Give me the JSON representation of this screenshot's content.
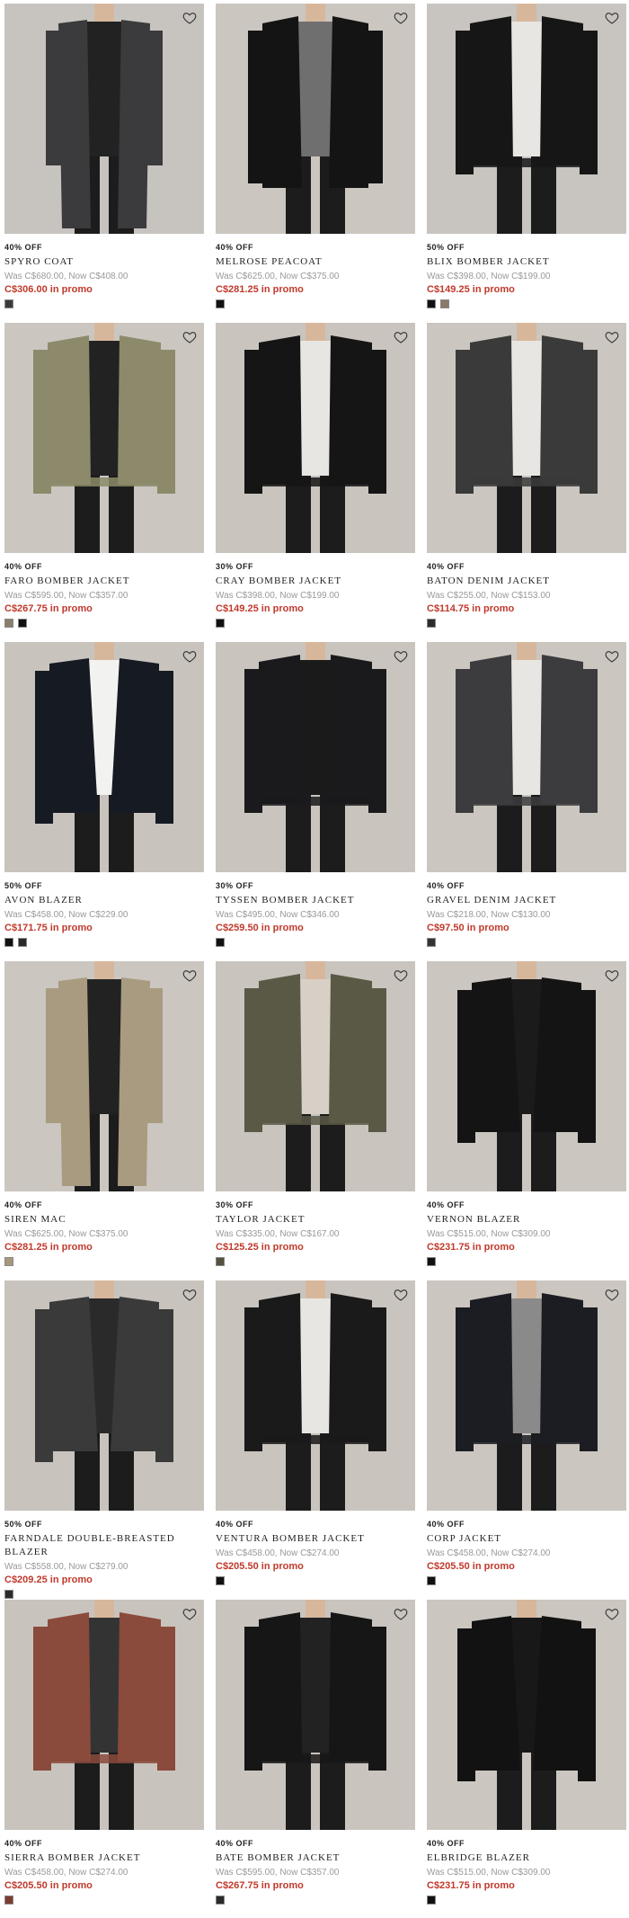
{
  "products": [
    {
      "discount": "40% OFF",
      "name": "SPYRO COAT",
      "was": "Was C$680.00, Now C$408.00",
      "promo": "C$306.00 in promo",
      "swatches": [
        "#3a3a3a"
      ],
      "garment": "#3b3b3d",
      "inner": "#222",
      "bg": "#c7c3bf",
      "style": "long"
    },
    {
      "discount": "40% OFF",
      "name": "MELROSE PEACOAT",
      "was": "Was C$625.00, Now C$375.00",
      "promo": "C$281.25 in promo",
      "swatches": [
        "#111111"
      ],
      "garment": "#141414",
      "inner": "#6f6f6f",
      "bg": "#cbc6c0",
      "style": "coat"
    },
    {
      "discount": "50% OFF",
      "name": "BLIX BOMBER JACKET",
      "was": "Was C$398.00, Now C$199.00",
      "promo": "C$149.25 in promo",
      "swatches": [
        "#111111",
        "#8a7a66"
      ],
      "garment": "#161616",
      "inner": "#e8e6e2",
      "bg": "#c8c4bf",
      "style": "bomber"
    },
    {
      "discount": "40% OFF",
      "name": "FARO BOMBER JACKET",
      "was": "Was C$595.00, Now C$357.00",
      "promo": "C$267.75 in promo",
      "swatches": [
        "#8a7f68",
        "#111111"
      ],
      "garment": "#8c8a6a",
      "inner": "#222",
      "bg": "#cbc6c0",
      "style": "bomber"
    },
    {
      "discount": "30% OFF",
      "name": "CRAY BOMBER JACKET",
      "was": "Was C$398.00, Now C$199.00",
      "promo": "C$149.25 in promo",
      "swatches": [
        "#111111"
      ],
      "garment": "#151515",
      "inner": "#e8e6e2",
      "bg": "#c9c4be",
      "style": "bomber"
    },
    {
      "discount": "40% OFF",
      "name": "BATON DENIM JACKET",
      "was": "Was C$255.00, Now C$153.00",
      "promo": "C$114.75 in promo",
      "swatches": [
        "#2b2b2b"
      ],
      "garment": "#3a3a3a",
      "inner": "#e8e6e2",
      "bg": "#cbc6c0",
      "style": "bomber"
    },
    {
      "discount": "50% OFF",
      "name": "AVON BLAZER",
      "was": "Was C$458.00, Now C$229.00",
      "promo": "C$171.75 in promo",
      "swatches": [
        "#111111",
        "#2a2a2a"
      ],
      "garment": "#161a22",
      "inner": "#f2f2f0",
      "bg": "#c8c3bd",
      "style": "blazer"
    },
    {
      "discount": "30% OFF",
      "name": "TYSSEN BOMBER JACKET",
      "was": "Was C$495.00, Now C$346.00",
      "promo": "C$259.50 in promo",
      "swatches": [
        "#111111"
      ],
      "garment": "#1a1a1c",
      "inner": "#1a1a1a",
      "bg": "#c9c4be",
      "style": "bomber"
    },
    {
      "discount": "40% OFF",
      "name": "GRAVEL DENIM JACKET",
      "was": "Was C$218.00, Now C$130.00",
      "promo": "C$97.50 in promo",
      "swatches": [
        "#333333"
      ],
      "garment": "#3c3c3e",
      "inner": "#e8e6e2",
      "bg": "#cbc6c0",
      "style": "bomber"
    },
    {
      "discount": "40% OFF",
      "name": "SIREN MAC",
      "was": "Was C$625.00, Now C$375.00",
      "promo": "C$281.25 in promo",
      "swatches": [
        "#a8987a"
      ],
      "garment": "#a89b80",
      "inner": "#222",
      "bg": "#cbc6c0",
      "style": "long"
    },
    {
      "discount": "30% OFF",
      "name": "TAYLOR JACKET",
      "was": "Was C$335.00, Now C$167.00",
      "promo": "C$125.25 in promo",
      "swatches": [
        "#555040"
      ],
      "garment": "#5a5946",
      "inner": "#d8d0c6",
      "bg": "#c9c4be",
      "style": "bomber"
    },
    {
      "discount": "40% OFF",
      "name": "VERNON BLAZER",
      "was": "Was C$515.00, Now C$309.00",
      "promo": "C$231.75 in promo",
      "swatches": [
        "#111111"
      ],
      "garment": "#141414",
      "inner": "#1b1b1b",
      "bg": "#cbc6c0",
      "style": "blazer"
    },
    {
      "discount": "50% OFF",
      "name": "FARNDALE DOUBLE-BREASTED BLAZER",
      "was": "Was C$558.00, Now C$279.00",
      "promo": "C$209.25 in promo",
      "swatches": [
        "#2a2a2a"
      ],
      "garment": "#3a3a3a",
      "inner": "#2a2a2a",
      "bg": "#c8c3bd",
      "style": "blazer"
    },
    {
      "discount": "40% OFF",
      "name": "VENTURA BOMBER JACKET",
      "was": "Was C$458.00, Now C$274.00",
      "promo": "C$205.50 in promo",
      "swatches": [
        "#111111"
      ],
      "garment": "#1a1a1a",
      "inner": "#e8e6e2",
      "bg": "#c9c4be",
      "style": "bomber"
    },
    {
      "discount": "40% OFF",
      "name": "CORP JACKET",
      "was": "Was C$458.00, Now C$274.00",
      "promo": "C$205.50 in promo",
      "swatches": [
        "#111111"
      ],
      "garment": "#1c1d22",
      "inner": "#8a8a8a",
      "bg": "#cbc6c0",
      "style": "bomber"
    },
    {
      "discount": "40% OFF",
      "name": "SIERRA BOMBER JACKET",
      "was": "Was C$458.00, Now C$274.00",
      "promo": "C$205.50 in promo",
      "swatches": [
        "#7a3d30"
      ],
      "garment": "#8a4a3c",
      "inner": "#333",
      "bg": "#c8c3bd",
      "style": "bomber"
    },
    {
      "discount": "40% OFF",
      "name": "BATE BOMBER JACKET",
      "was": "Was C$595.00, Now C$357.00",
      "promo": "C$267.75 in promo",
      "swatches": [
        "#2a2a2a"
      ],
      "garment": "#161616",
      "inner": "#222",
      "bg": "#c9c4be",
      "style": "bomber"
    },
    {
      "discount": "40% OFF",
      "name": "ELBRIDGE BLAZER",
      "was": "Was C$515.00, Now C$309.00",
      "promo": "C$231.75 in promo",
      "swatches": [
        "#111111"
      ],
      "garment": "#121212",
      "inner": "#181818",
      "bg": "#cbc6c0",
      "style": "blazer"
    }
  ],
  "icons": {
    "favorite": "heart-outline-icon"
  },
  "colors": {
    "promo": "#c0392b",
    "muted": "#999999"
  }
}
